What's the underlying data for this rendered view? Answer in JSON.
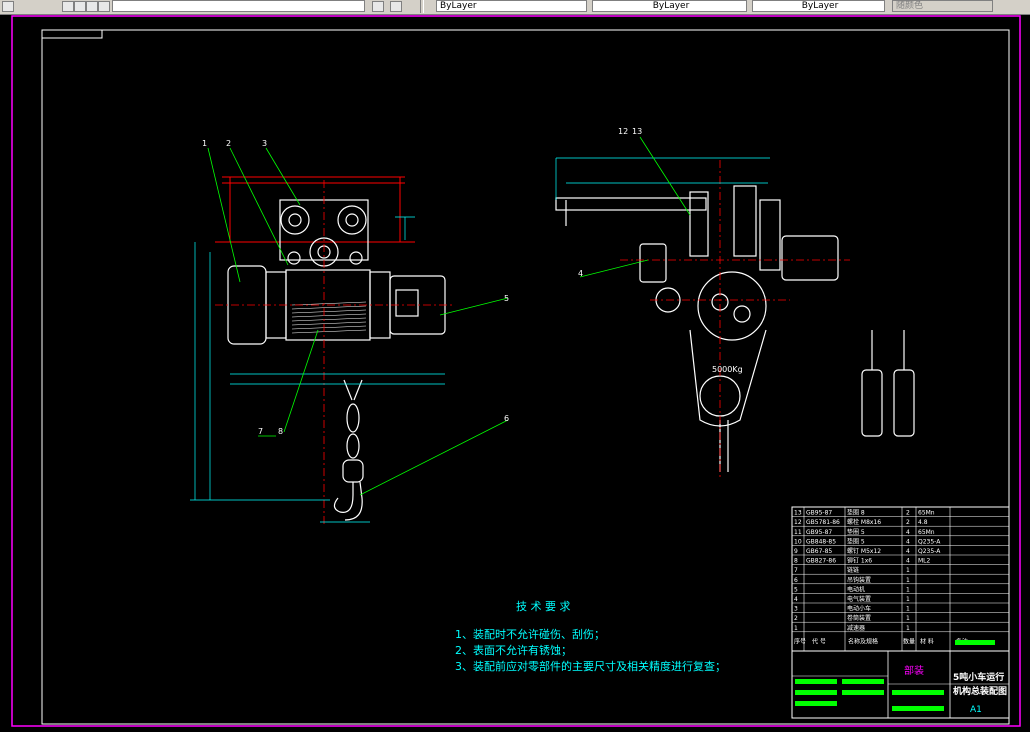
{
  "toolbar": {
    "layer_dropdown": "ByLayer",
    "linetype_dropdown": "ByLayer",
    "lineweight_dropdown": "ByLayer",
    "plotstyle_dropdown": "随颜色"
  },
  "drawing": {
    "balloons_front": [
      "1",
      "2",
      "3",
      "5",
      "6",
      "7",
      "8"
    ],
    "balloons_side": [
      "12",
      "13",
      "4"
    ],
    "load_label": "5000Kg",
    "tech_title": "技 术 要 求",
    "tech_notes": [
      "1、装配时不允许碰伤、刮伤；",
      "2、表面不允许有锈蚀；",
      "3、装配前应对零部件的主要尺寸及相关精度进行复查；"
    ]
  },
  "bom": {
    "rows": [
      {
        "no": "13",
        "std": "GB95-87",
        "name": "垫圈  8",
        "qty": "2",
        "mat": "65Mn"
      },
      {
        "no": "12",
        "std": "GB5781-86",
        "name": "螺栓  M8x16",
        "qty": "2",
        "mat": "4.8"
      },
      {
        "no": "11",
        "std": "GB95-87",
        "name": "垫圈  5",
        "qty": "4",
        "mat": "65Mn"
      },
      {
        "no": "10",
        "std": "GB848-85",
        "name": "垫圈  5",
        "qty": "4",
        "mat": "Q235-A"
      },
      {
        "no": "9",
        "std": "GB67-85",
        "name": "螺钉  M5x12",
        "qty": "4",
        "mat": "Q235-A"
      },
      {
        "no": "8",
        "std": "GB827-86",
        "name": "铆钉  1x6",
        "qty": "4",
        "mat": "ML2"
      },
      {
        "no": "7",
        "std": "",
        "name": "链链",
        "qty": "1",
        "mat": ""
      },
      {
        "no": "6",
        "std": "",
        "name": "吊钩装置",
        "qty": "1",
        "mat": ""
      },
      {
        "no": "5",
        "std": "",
        "name": "电动机",
        "qty": "1",
        "mat": ""
      },
      {
        "no": "4",
        "std": "",
        "name": "电气装置",
        "qty": "1",
        "mat": ""
      },
      {
        "no": "3",
        "std": "",
        "name": "电动小车",
        "qty": "1",
        "mat": ""
      },
      {
        "no": "2",
        "std": "",
        "name": "卷筒装置",
        "qty": "1",
        "mat": ""
      },
      {
        "no": "1",
        "std": "",
        "name": "减速器",
        "qty": "1",
        "mat": ""
      }
    ],
    "header": {
      "no": "序号",
      "code": "代    号",
      "name": "名称及规格",
      "qty": "数量",
      "mat": "材    料",
      "remark": "备注"
    }
  },
  "title_block": {
    "drawing_title_1": "5吨小车运行",
    "drawing_title_2": "机构总装配图",
    "assembly_label": "部装",
    "sheet_size": "A1"
  },
  "colors": {
    "background": "#000000",
    "border_magenta": "#ff00ff",
    "line_white": "#ffffff",
    "center_red": "#ff0000",
    "dim_cyan": "#00ffff",
    "leader_green": "#00ff00"
  }
}
